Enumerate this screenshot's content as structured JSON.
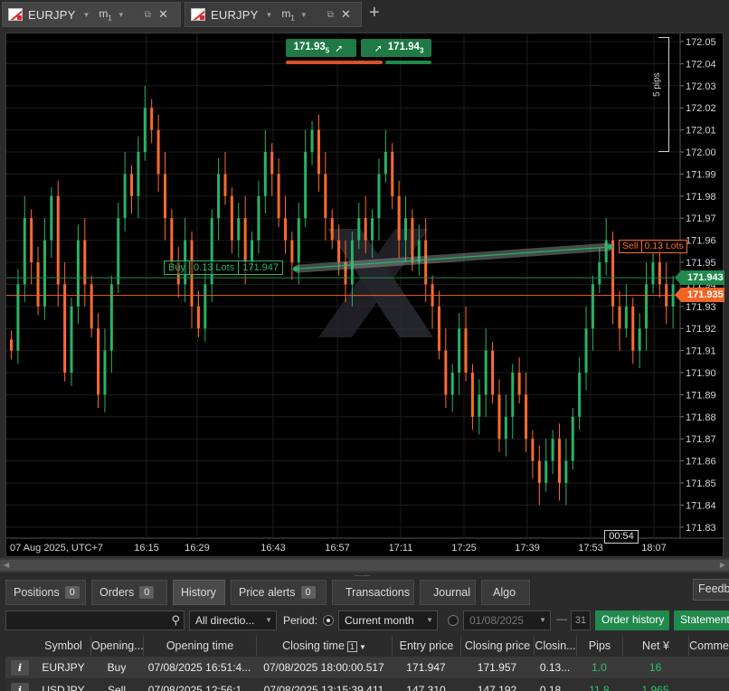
{
  "tabs": [
    {
      "symbol": "EURJPY",
      "timeframe": "m",
      "timeframe_sub": "1",
      "active": true
    },
    {
      "symbol": "EURJPY",
      "timeframe": "m",
      "timeframe_sub": "1",
      "active": false
    }
  ],
  "icons": {
    "flag": "eur-jpy-flag-icon",
    "detach": "detach-window-icon",
    "close": "close-icon",
    "add": "plus-icon",
    "search": "magnifier-icon"
  },
  "colors": {
    "bull": "#27b366",
    "bear": "#ff6a2e",
    "buy_accent": "#1f8a4c",
    "sell_accent": "#f06426",
    "background": "#000000"
  },
  "quote": {
    "sell_price": "171.93",
    "sell_pip": "5",
    "buy_price": "171.94",
    "buy_pip": "3"
  },
  "pips_scale_label": "5 pips",
  "price_axis": [
    "172.05",
    "172.04",
    "172.03",
    "172.02",
    "172.01",
    "172.00",
    "171.99",
    "171.98",
    "171.97",
    "171.96",
    "171.95",
    "171.94",
    "171.93",
    "171.92",
    "171.91",
    "171.90",
    "171.89",
    "171.88",
    "171.87",
    "171.86",
    "171.85",
    "171.84",
    "171.83"
  ],
  "time_axis": [
    "07 Aug 2025, UTC+7",
    "16:15",
    "16:29",
    "16:43",
    "16:57",
    "17:11",
    "17:25",
    "17:39",
    "17:53",
    "18:07"
  ],
  "bid_tag": "171.943",
  "ask_tag": "171.935",
  "countdown": "00:54",
  "buy_marker": {
    "side": "Buy",
    "volume": "0.13 Lots",
    "price": "171.947"
  },
  "sell_marker": {
    "side": "Sell",
    "volume": "0.13 Lots"
  },
  "chart_data": {
    "type": "candlestick",
    "title": "",
    "symbol": "EURJPY",
    "timeframe": "m1",
    "ylim": [
      171.83,
      172.05
    ],
    "time_range": [
      "16:04",
      "18:07"
    ],
    "trade_line": {
      "open_price": 171.947,
      "close_price": 171.957
    },
    "closes": [
      171.91,
      171.94,
      171.97,
      171.95,
      171.93,
      171.96,
      171.98,
      171.94,
      171.9,
      171.93,
      171.96,
      171.94,
      171.92,
      171.89,
      171.91,
      171.94,
      171.97,
      171.99,
      171.98,
      172.0,
      172.02,
      172.01,
      171.99,
      171.97,
      171.95,
      171.94,
      171.96,
      171.93,
      171.92,
      171.94,
      171.97,
      171.99,
      171.98,
      171.96,
      171.97,
      171.95,
      171.96,
      171.98,
      172.0,
      171.99,
      171.97,
      171.96,
      171.95,
      171.97,
      172.0,
      172.01,
      171.99,
      171.97,
      171.96,
      171.95,
      171.94,
      171.96,
      171.97,
      171.96,
      171.97,
      171.99,
      172.0,
      171.98,
      171.96,
      171.97,
      171.95,
      171.96,
      171.94,
      171.93,
      171.91,
      171.89,
      171.9,
      171.92,
      171.9,
      171.88,
      171.89,
      171.91,
      171.89,
      171.87,
      171.88,
      171.9,
      171.89,
      171.87,
      171.86,
      171.85,
      171.86,
      171.87,
      171.85,
      171.86,
      171.88,
      171.9,
      171.92,
      171.94,
      171.95,
      171.96,
      171.93,
      171.92,
      171.93,
      171.91,
      171.92,
      171.94,
      171.95,
      171.94,
      171.93,
      171.94
    ],
    "last_price": 171.935
  },
  "panel": {
    "tabs": [
      {
        "label": "Positions",
        "badge": "0"
      },
      {
        "label": "Orders",
        "badge": "0"
      },
      {
        "label": "History",
        "badge": ""
      },
      {
        "label": "Price alerts",
        "badge": "0"
      },
      {
        "label": "Transactions",
        "badge": ""
      },
      {
        "label": "Journal",
        "badge": ""
      },
      {
        "label": "Algo",
        "badge": ""
      }
    ],
    "feedback": "Feedback",
    "direction": "All directio...",
    "period_label": "Period:",
    "period_value": "Current month",
    "date_from": "01/08/2025",
    "date_to_day": "31",
    "order_history_btn": "Order history",
    "statement_btn": "Statement",
    "columns": [
      "Symbol",
      "Opening...",
      "Opening time",
      "Closing time",
      "Entry price",
      "Closing price",
      "Closin...",
      "Pips",
      "Net ¥",
      "Comme"
    ],
    "closing_time_sort": "1",
    "rows": [
      {
        "symbol": "EURJPY",
        "side": "Buy",
        "open_time": "07/08/2025 16:51:4...",
        "close_time": "07/08/2025 18:00:00.517",
        "entry": "171.947",
        "close": "171.957",
        "closing_vol": "0.13...",
        "pips": "1.0",
        "net": "16"
      },
      {
        "symbol": "USDJPY",
        "side": "Sell",
        "open_time": "07/08/2025 12:56:1...",
        "close_time": "07/08/2025 13:15:39.411",
        "entry": "147.310",
        "close": "147.192",
        "closing_vol": "0.18...",
        "pips": "11.8",
        "net": "1,965"
      }
    ]
  }
}
